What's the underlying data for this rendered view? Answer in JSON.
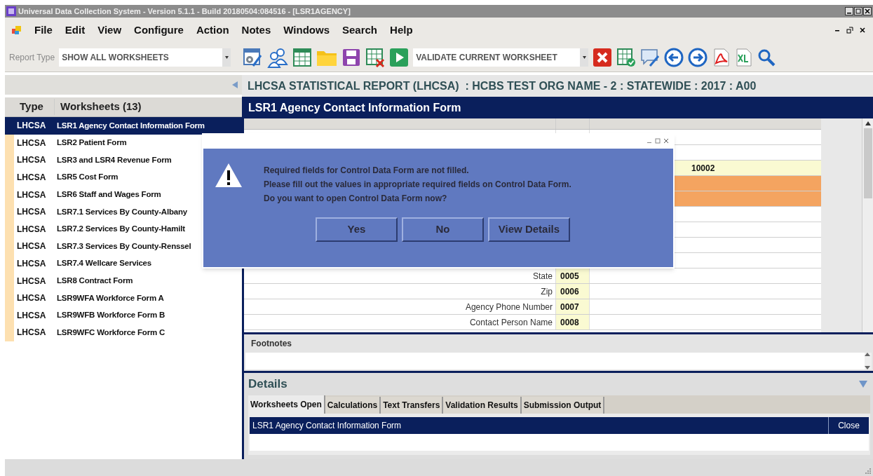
{
  "window": {
    "title": "Universal Data Collection System - Version 5.1.1 - Build 20180504:084516 - [LSR1AGENCY]"
  },
  "menu": [
    "File",
    "Edit",
    "View",
    "Configure",
    "Action",
    "Notes",
    "Windows",
    "Search",
    "Help"
  ],
  "toolbar": {
    "report_type_label": "Report Type",
    "report_type_value": "SHOW ALL WORKSHEETS",
    "action_value": "VALIDATE CURRENT WORKSHEET"
  },
  "worksheets": {
    "columns": [
      "Type",
      "Worksheets (13)"
    ],
    "rows": [
      {
        "type": "LHCSA",
        "name": "LSR1 Agency Contact Information Form",
        "selected": true
      },
      {
        "type": "LHCSA",
        "name": "LSR2 Patient Form",
        "selected": false
      },
      {
        "type": "LHCSA",
        "name": "LSR3 and LSR4 Revenue Form",
        "selected": false
      },
      {
        "type": "LHCSA",
        "name": "LSR5 Cost Form",
        "selected": false
      },
      {
        "type": "LHCSA",
        "name": "LSR6 Staff and Wages Form",
        "selected": false
      },
      {
        "type": "LHCSA",
        "name": "LSR7.1 Services By County-Albany",
        "selected": false
      },
      {
        "type": "LHCSA",
        "name": "LSR7.2 Services By County-Hamilt",
        "selected": false
      },
      {
        "type": "LHCSA",
        "name": "LSR7.3 Services By County-Renssel",
        "selected": false
      },
      {
        "type": "LHCSA",
        "name": "LSR7.4 Wellcare Services",
        "selected": false
      },
      {
        "type": "LHCSA",
        "name": "LSR8 Contract Form",
        "selected": false
      },
      {
        "type": "LHCSA",
        "name": "LSR9WFA  Workforce Form A",
        "selected": false
      },
      {
        "type": "LHCSA",
        "name": "LSR9WFB Workforce Form B",
        "selected": false
      },
      {
        "type": "LHCSA",
        "name": "LSR9WFC  Workforce Form C",
        "selected": false
      }
    ]
  },
  "report_title": "LHCSA STATISTICAL REPORT (LHCSA)  : HCBS TEST ORG NAME - 2 : STATEWIDE : 2017 : A00",
  "form_title": "LSR1 Agency Contact Information Form",
  "form_rows": [
    {
      "kind": "plain"
    },
    {
      "kind": "plain"
    },
    {
      "kind": "value",
      "value": "10002"
    },
    {
      "kind": "highlighted"
    },
    {
      "kind": "highlighted"
    },
    {
      "kind": "plain"
    },
    {
      "kind": "plain"
    },
    {
      "kind": "plain"
    },
    {
      "kind": "plain"
    },
    {
      "kind": "field",
      "label": "State",
      "code": "0005"
    },
    {
      "kind": "field",
      "label": "Zip",
      "code": "0006"
    },
    {
      "kind": "field",
      "label": "Agency Phone Number",
      "code": "0007"
    },
    {
      "kind": "field",
      "label": "Contact Person Name",
      "code": "0008"
    }
  ],
  "footnotes": {
    "label": "Footnotes"
  },
  "details": {
    "title": "Details",
    "tabs": [
      {
        "label": "Worksheets Open",
        "selected": true
      },
      {
        "label": "Calculations",
        "selected": false
      },
      {
        "label": "Text Transfers",
        "selected": false
      },
      {
        "label": "Validation Results",
        "selected": false
      },
      {
        "label": "Submission Output",
        "selected": false
      }
    ],
    "open_rows": [
      {
        "name": "LSR1 Agency Contact Information Form",
        "action": "Close"
      }
    ]
  },
  "dialog": {
    "message": [
      "Required fields for Control Data Form are not filled.",
      "Please fill out the values in appropriate required fields on Control Data Form.",
      "Do you want to open Control Data Form now?"
    ],
    "buttons": [
      "Yes",
      "No",
      "View Details"
    ]
  }
}
